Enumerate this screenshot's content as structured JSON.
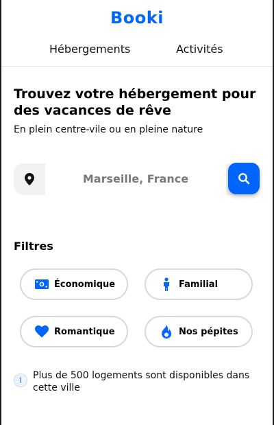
{
  "header": {
    "logo": "Booki",
    "nav": [
      {
        "label": "Hébergements"
      },
      {
        "label": "Activités"
      }
    ]
  },
  "hero": {
    "title": "Trouvez votre hébergement pour des vacances de rêve",
    "subtitle": "En plein centre-vile ou en pleine nature"
  },
  "search": {
    "value": "Marseille, France",
    "location_icon": "map-pin-icon",
    "button_icon": "search-icon"
  },
  "filters": {
    "title": "Filtres",
    "items": [
      {
        "label": "Économique",
        "icon": "money-icon"
      },
      {
        "label": "Familial",
        "icon": "person-icon"
      },
      {
        "label": "Romantique",
        "icon": "heart-icon"
      },
      {
        "label": "Nos pépites",
        "icon": "fire-icon"
      }
    ]
  },
  "info": {
    "icon": "info-icon",
    "text": "Plus de 500 logements sont disponibles dans cette ville"
  },
  "colors": {
    "accent": "#0065fc",
    "chip_border": "#d9d9d9",
    "search_bg": "#f2f2f2"
  }
}
